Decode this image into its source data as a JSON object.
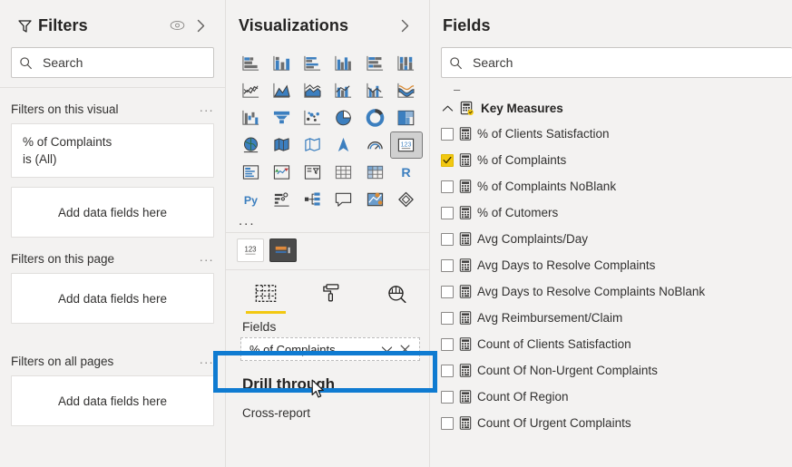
{
  "filters": {
    "title": "Filters",
    "icons": {
      "funnel": "funnel-icon",
      "eye": "eye-icon",
      "expand": "chevron-right-icon"
    },
    "search_placeholder": "Search",
    "sections": [
      {
        "label": "Filters on this visual",
        "cards": [
          {
            "line1": "% of Complaints",
            "line2": "is (All)"
          }
        ],
        "dropzone": "Add data fields here"
      },
      {
        "label": "Filters on this page",
        "cards": [],
        "dropzone": "Add data fields here"
      },
      {
        "label": "Filters on all pages",
        "cards": [],
        "dropzone": "Add data fields here"
      }
    ],
    "more_glyph": "..."
  },
  "visualizations": {
    "title": "Visualizations",
    "expand_icon": "chevron-right-icon",
    "more_glyph": "...",
    "icons": [
      "stacked-bar-chart-icon",
      "stacked-column-chart-icon",
      "clustered-bar-chart-icon",
      "clustered-column-chart-icon",
      "100-stacked-bar-chart-icon",
      "100-stacked-column-chart-icon",
      "line-chart-icon",
      "area-chart-icon",
      "stacked-area-chart-icon",
      "line-stacked-column-chart-icon",
      "line-clustered-column-chart-icon",
      "ribbon-chart-icon",
      "waterfall-chart-icon",
      "funnel-chart-icon",
      "scatter-chart-icon",
      "pie-chart-icon",
      "donut-chart-icon",
      "treemap-icon",
      "map-icon",
      "filled-map-icon",
      "shape-map-icon",
      "arcgis-map-icon",
      "gauge-icon",
      "card-icon",
      "multi-row-card-icon",
      "kpi-icon",
      "slicer-icon",
      "table-icon",
      "matrix-icon",
      "r-script-visual-icon",
      "python-visual-icon",
      "key-influencers-icon",
      "decomposition-tree-icon",
      "q-and-a-icon",
      "smart-narrative-icon",
      "paginated-report-icon"
    ],
    "selected_icon_index": 23,
    "second_row_icons": [
      "card-123-icon",
      "multi-row-card-thumbnail-icon"
    ],
    "second_row_selected_index": 1,
    "tabs": [
      {
        "label": "Fields",
        "icon": "fields-table-icon",
        "active": true
      },
      {
        "label": "Format",
        "icon": "paint-roller-icon",
        "active": false
      },
      {
        "label": "Analytics",
        "icon": "analytics-magnifier-icon",
        "active": false
      }
    ],
    "wells_label": "Fields",
    "well_field": {
      "name": "% of Complaints",
      "dropdown_icon": "chevron-down-icon",
      "remove_icon": "close-icon"
    },
    "drill_through_title": "Drill through",
    "cross_report_label": "Cross-report",
    "highlight_color": "#0f7bd1",
    "cursor": "mouse-pointer"
  },
  "fields": {
    "title": "Fields",
    "search_placeholder": "Search",
    "collapse_glyph": "–",
    "table": {
      "name": "Key Measures",
      "icon": "measure-table-icon",
      "chevron": "chevron-up-icon",
      "expanded": true
    },
    "items": [
      {
        "label": "% of Clients Satisfaction",
        "checked": false,
        "icon": "measure-icon"
      },
      {
        "label": "% of Complaints",
        "checked": true,
        "icon": "measure-icon"
      },
      {
        "label": "% of Complaints NoBlank",
        "checked": false,
        "icon": "measure-icon"
      },
      {
        "label": "% of Cutomers",
        "checked": false,
        "icon": "measure-icon"
      },
      {
        "label": "Avg Complaints/Day",
        "checked": false,
        "icon": "measure-icon"
      },
      {
        "label": "Avg Days to Resolve Complaints",
        "checked": false,
        "icon": "measure-icon"
      },
      {
        "label": "Avg Days to Resolve Complaints NoBlank",
        "checked": false,
        "icon": "measure-icon"
      },
      {
        "label": "Avg Reimbursement/Claim",
        "checked": false,
        "icon": "measure-icon"
      },
      {
        "label": "Count of Clients Satisfaction",
        "checked": false,
        "icon": "measure-icon"
      },
      {
        "label": "Count Of Non-Urgent Complaints",
        "checked": false,
        "icon": "measure-icon"
      },
      {
        "label": "Count Of Region",
        "checked": false,
        "icon": "measure-icon"
      },
      {
        "label": "Count Of Urgent Complaints",
        "checked": false,
        "icon": "measure-icon"
      }
    ],
    "checked_color": "#f2c811"
  }
}
